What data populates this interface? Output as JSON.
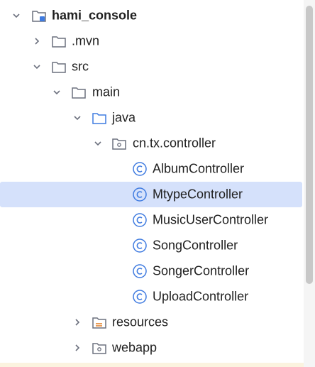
{
  "tree": {
    "root": {
      "label": "hami_console",
      "icon": "module-folder-icon"
    },
    "mvn": {
      "label": ".mvn",
      "icon": "folder-icon"
    },
    "src": {
      "label": "src",
      "icon": "folder-icon"
    },
    "main": {
      "label": "main",
      "icon": "folder-icon"
    },
    "java": {
      "label": "java",
      "icon": "source-root-folder-icon"
    },
    "package": {
      "label": "cn.tx.controller",
      "icon": "package-icon"
    },
    "classes": [
      {
        "label": "AlbumController",
        "icon": "class-icon"
      },
      {
        "label": "MtypeController",
        "icon": "class-icon",
        "selected": true
      },
      {
        "label": "MusicUserController",
        "icon": "class-icon"
      },
      {
        "label": "SongController",
        "icon": "class-icon"
      },
      {
        "label": "SongerController",
        "icon": "class-icon"
      },
      {
        "label": "UploadController",
        "icon": "class-icon"
      }
    ],
    "resources": {
      "label": "resources",
      "icon": "resources-folder-icon"
    },
    "webapp": {
      "label": "webapp",
      "icon": "web-folder-icon"
    }
  },
  "colors": {
    "selection": "#d5e1fb",
    "class_icon": "#3f7be0",
    "folder_stroke": "#6c707e",
    "source_root": "#3f7be0",
    "resources_accent": "#e07b20"
  }
}
